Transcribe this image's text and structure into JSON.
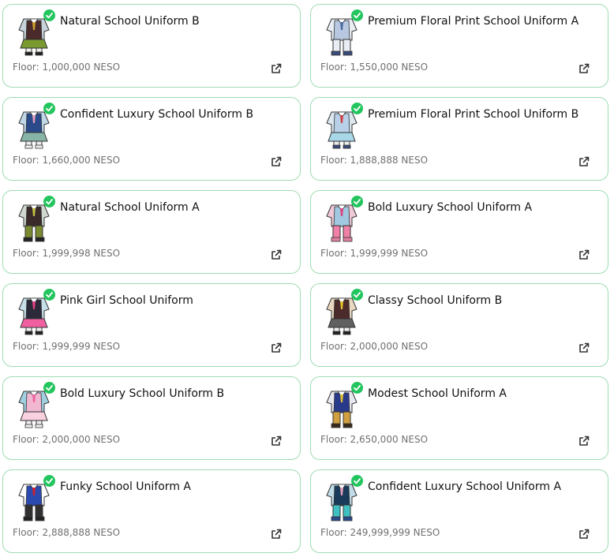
{
  "colors": {
    "card_border": "#9fdcb2",
    "verified_check": "#23c55e",
    "floor_text": "#707070",
    "name_text": "#111111"
  },
  "icons": {
    "verified": "verified-check-icon",
    "external_link": "external-link-icon",
    "item_thumbnail": "uniform-outfit-icon"
  },
  "floor_prefix": "Floor:",
  "items": [
    {
      "name": "Natural School Uniform B",
      "floor_value": "1,000,000 NESO",
      "style": {
        "top": "#c8d4dc",
        "vest": "#4a2a2a",
        "bottom": "#7a9a30",
        "tie": "#d0a030",
        "shoes": "#222222",
        "skirt": true
      }
    },
    {
      "name": "Premium Floral Print School Uniform A",
      "floor_value": "1,550,000 NESO",
      "style": {
        "top": "#e8eef4",
        "vest": "#b8c8e0",
        "bottom": "#e8eef4",
        "tie": "#4a6aa0",
        "shoes": "#3a4a7a",
        "skirt": false
      }
    },
    {
      "name": "Confident Luxury School Uniform B",
      "floor_value": "1,660,000 NESO",
      "style": {
        "top": "#c0d8e8",
        "vest": "#2a4a8a",
        "bottom": "#88b4a8",
        "tie": "#e0a0b8",
        "shoes": "#f0f0f0",
        "skirt": true
      }
    },
    {
      "name": "Premium Floral Print School Uniform B",
      "floor_value": "1,888,888 NESO",
      "style": {
        "top": "#dce8f0",
        "vest": "#b8d0e8",
        "bottom": "#a8d8e8",
        "tie": "#d04040",
        "shoes": "#3a4a7a",
        "skirt": true
      }
    },
    {
      "name": "Natural School Uniform A",
      "floor_value": "1,999,998 NESO",
      "style": {
        "top": "#d0d8d0",
        "vest": "#3a2a2a",
        "bottom": "#7a8a30",
        "tie": "#c0c040",
        "shoes": "#222222",
        "skirt": false
      }
    },
    {
      "name": "Bold Luxury School Uniform A",
      "floor_value": "1,999,999 NESO",
      "style": {
        "top": "#f0c8d8",
        "vest": "#a0c8e0",
        "bottom": "#f080a8",
        "tie": "#e04080",
        "shoes": "#e080a0",
        "skirt": false
      }
    },
    {
      "name": "Pink Girl School Uniform",
      "floor_value": "1,999,999 NESO",
      "style": {
        "top": "#c8e0e8",
        "vest": "#2a2a3a",
        "bottom": "#f060a0",
        "tie": "#e04080",
        "shoes": "#222222",
        "skirt": true
      }
    },
    {
      "name": "Classy School Uniform B",
      "floor_value": "2,000,000 NESO",
      "style": {
        "top": "#e8d8c0",
        "vest": "#4a2a2a",
        "bottom": "#606060",
        "tie": "#e0c030",
        "shoes": "#222222",
        "skirt": true
      }
    },
    {
      "name": "Bold Luxury School Uniform B",
      "floor_value": "2,000,000 NESO",
      "style": {
        "top": "#a0d0e0",
        "vest": "#f0b8d0",
        "bottom": "#f8d0e0",
        "tie": "#f060a0",
        "shoes": "#f0f0f0",
        "skirt": true
      }
    },
    {
      "name": "Modest School Uniform A",
      "floor_value": "2,650,000 NESO",
      "style": {
        "top": "#e8e8f0",
        "vest": "#2a3a8a",
        "bottom": "#d0a040",
        "tie": "#e0c030",
        "shoes": "#3a2a1a",
        "skirt": false
      }
    },
    {
      "name": "Funky School Uniform A",
      "floor_value": "2,888,888 NESO",
      "style": {
        "top": "#ffffff",
        "vest": "#2a4ab0",
        "bottom": "#303030",
        "tie": "#d02030",
        "shoes": "#222222",
        "skirt": false
      }
    },
    {
      "name": "Confident Luxury School Uniform A",
      "floor_value": "249,999,999 NESO",
      "style": {
        "top": "#c0dce8",
        "vest": "#1a3a5a",
        "bottom": "#40c0c0",
        "tie": "#e0a0b8",
        "shoes": "#2a4a8a",
        "skirt": false
      }
    }
  ]
}
